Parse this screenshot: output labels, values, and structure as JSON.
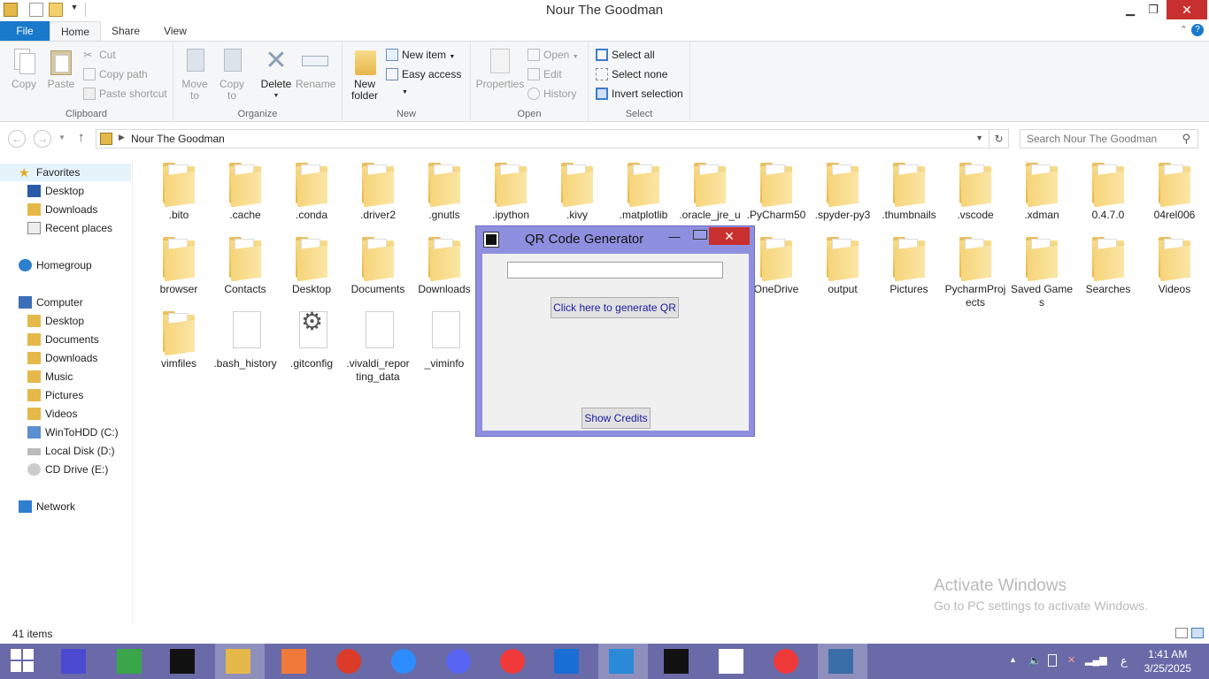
{
  "window": {
    "title": "Nour The Goodman"
  },
  "tabs": [
    "File",
    "Home",
    "Share",
    "View"
  ],
  "ribbon": {
    "clipboard": {
      "label": "Clipboard",
      "copy": "Copy",
      "paste": "Paste",
      "cut": "Cut",
      "copy_path": "Copy path",
      "paste_shortcut": "Paste shortcut"
    },
    "organize": {
      "label": "Organize",
      "move_to": "Move to",
      "copy_to": "Copy to",
      "delete": "Delete",
      "rename": "Rename"
    },
    "new": {
      "label": "New",
      "new_folder": "New folder",
      "new_item": "New item",
      "easy_access": "Easy access"
    },
    "open": {
      "label": "Open",
      "properties": "Properties",
      "open": "Open",
      "edit": "Edit",
      "history": "History"
    },
    "select": {
      "label": "Select",
      "select_all": "Select all",
      "select_none": "Select none",
      "invert_selection": "Invert selection"
    }
  },
  "address": {
    "path": "Nour The Goodman",
    "search_placeholder": "Search Nour The Goodman"
  },
  "navpane": {
    "favorites": "Favorites",
    "fav_items": [
      "Desktop",
      "Downloads",
      "Recent places"
    ],
    "homegroup": "Homegroup",
    "computer": "Computer",
    "comp_items": [
      "Desktop",
      "Documents",
      "Downloads",
      "Music",
      "Pictures",
      "Videos",
      "WinToHDD (C:)",
      "Local Disk (D:)",
      "CD Drive (E:)"
    ],
    "network": "Network"
  },
  "items_row1": [
    ".bito",
    ".cache",
    ".conda",
    ".driver2",
    ".gnutls",
    ".ipython",
    ".kivy",
    ".matplotlib",
    ".oracle_jre_usage",
    ".PyCharm50",
    ".spyder-py3",
    ".thumbnails",
    ".vscode",
    ".xdman",
    "0.4.7.0",
    "04rel006"
  ],
  "items_row2_left": [
    "browser",
    "Contacts",
    "Desktop",
    "Documents",
    "Downloads"
  ],
  "items_row2_right": [
    "OneDrive",
    "output",
    "Pictures",
    "PycharmProjects",
    "Saved Games",
    "Searches",
    "Videos"
  ],
  "items_row3": [
    {
      "name": "vimfiles",
      "kind": "folder"
    },
    {
      "name": ".bash_history",
      "kind": "file"
    },
    {
      "name": ".gitconfig",
      "kind": "gear"
    },
    {
      "name": ".vivaldi_reporting_data",
      "kind": "file"
    },
    {
      "name": "_viminfo",
      "kind": "file"
    }
  ],
  "status": {
    "count": "41 items"
  },
  "watermark": {
    "line1": "Activate Windows",
    "line2": "Go to PC settings to activate Windows."
  },
  "dialog": {
    "title": "QR Code Generator",
    "input_value": "",
    "generate_label": "Click here to generate QR",
    "credits_label": "Show Credits"
  },
  "taskbar": {
    "apps": [
      "start",
      "settings",
      "tile-app",
      "cmd",
      "file-explorer",
      "photo-app",
      "chrome",
      "zoom",
      "discord",
      "vivaldi",
      "streamline",
      "vscode",
      "pycharm",
      "capcut",
      "vivaldi-2",
      "python"
    ],
    "time": "1:41 AM",
    "date": "3/25/2025",
    "lang": "ع"
  },
  "colors": {
    "accent": "#1979ca",
    "taskbar": "#6a6aa8",
    "dialog_frame": "#8f8fe0",
    "close": "#c7302e"
  }
}
